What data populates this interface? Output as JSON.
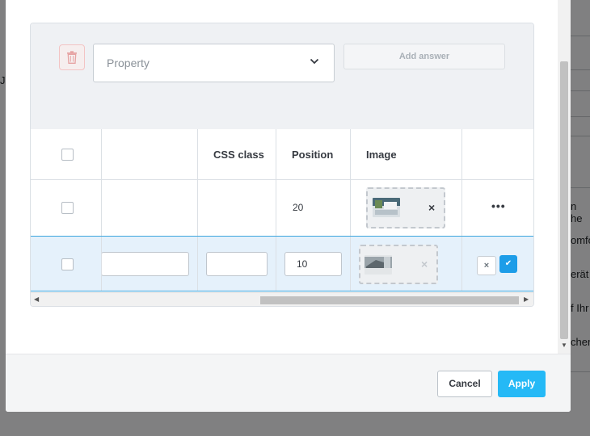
{
  "background": {
    "fragments": [
      "n he",
      "omfo",
      "erät",
      "f Ihr",
      "chen"
    ],
    "left_fragment": "JC"
  },
  "toolbar": {
    "property_placeholder": "Property",
    "add_answer_label": "Add answer"
  },
  "table": {
    "headers": [
      "",
      "",
      "CSS class",
      "Position",
      "Image",
      ""
    ],
    "rows": [
      {
        "position": "20",
        "image_remove": "×",
        "actions": "•••"
      },
      {
        "position_input": "10",
        "image_remove": "×",
        "cancel": "×",
        "confirm": "✔"
      }
    ]
  },
  "footer": {
    "cancel_label": "Cancel",
    "apply_label": "Apply"
  },
  "colors": {
    "primary": "#25b9f6",
    "row_selected": "#e5f1fb",
    "row_border": "#3ba5de"
  }
}
